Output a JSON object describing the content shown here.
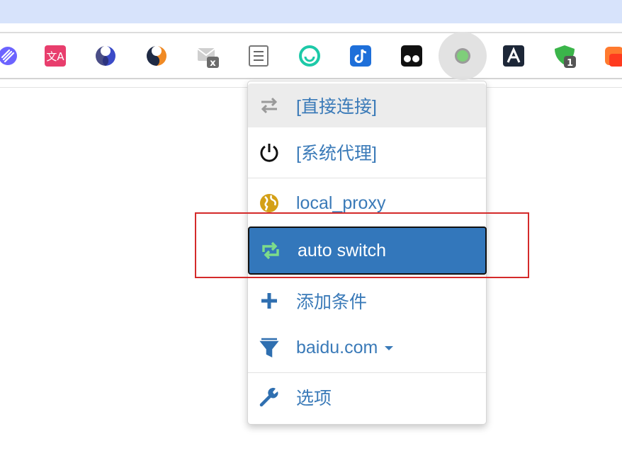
{
  "colors": {
    "accent": "#3377bb",
    "menu_text": "#3a7ab8",
    "annotation": "#d42a2a",
    "topbar": "#d7e3fb"
  },
  "toolbar": {
    "extensions": [
      {
        "name": "link-extension-icon"
      },
      {
        "name": "translate-extension-icon"
      },
      {
        "name": "blue-swirl-extension-icon"
      },
      {
        "name": "orange-swirl-extension-icon"
      },
      {
        "name": "mail-blocked-extension-icon"
      },
      {
        "name": "reader-extension-icon"
      },
      {
        "name": "green-circle-extension-icon"
      },
      {
        "name": "tiktok-extension-icon"
      },
      {
        "name": "tampermonkey-extension-icon"
      },
      {
        "name": "proxy-switch-extension-icon",
        "active": true
      },
      {
        "name": "a-logo-extension-icon"
      },
      {
        "name": "green-shield-extension-icon",
        "badge": "1"
      },
      {
        "name": "orange-extension-icon"
      }
    ]
  },
  "menu": {
    "items": [
      {
        "label": "[直接连接]",
        "icon": "swap-arrows-icon"
      },
      {
        "label": "[系统代理]",
        "icon": "power-icon"
      },
      {
        "label": "local_proxy",
        "icon": "globe-icon"
      },
      {
        "label": "auto switch",
        "icon": "retweet-icon"
      },
      {
        "label": "添加条件",
        "icon": "plus-icon"
      },
      {
        "label": "baidu.com",
        "icon": "filter-icon"
      },
      {
        "label": "选项",
        "icon": "wrench-icon"
      }
    ]
  }
}
